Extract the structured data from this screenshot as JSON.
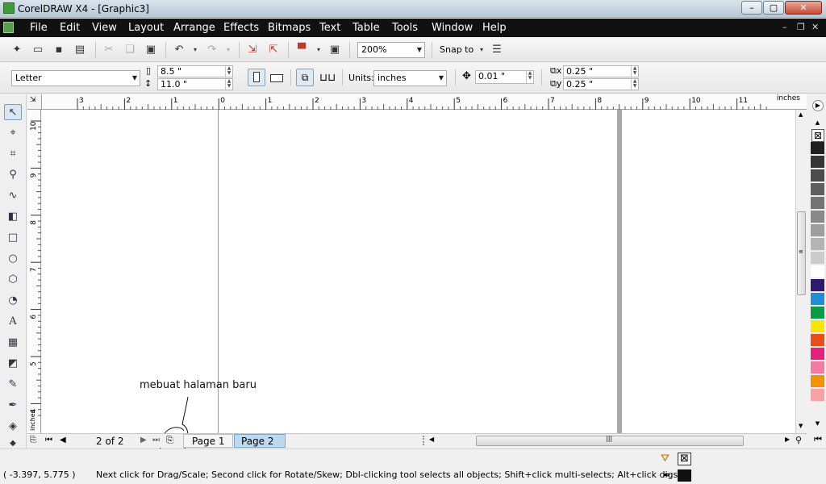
{
  "app": {
    "title": "CorelDRAW X4 - [Graphic3]"
  },
  "menu": [
    "File",
    "Edit",
    "View",
    "Layout",
    "Arrange",
    "Effects",
    "Bitmaps",
    "Text",
    "Table",
    "Tools",
    "Window",
    "Help"
  ],
  "toolbar": {
    "zoom": "200%",
    "snap_to": "Snap to"
  },
  "property_bar": {
    "page_size": "Letter",
    "width": "8.5 \"",
    "height": "11.0 \"",
    "units_label": "Units:",
    "units_value": "inches",
    "nudge": "0.01 \"",
    "dup_x": "0.25 \"",
    "dup_y": "0.25 \""
  },
  "ruler": {
    "units_label": "inches",
    "h_ticks": [
      "3",
      "2",
      "1",
      "0",
      "1",
      "2",
      "3",
      "4",
      "5",
      "6",
      "7",
      "8",
      "9",
      "10",
      "11"
    ],
    "v_ticks": [
      "10",
      "9",
      "8",
      "7",
      "6",
      "5",
      "4"
    ],
    "v_units": "inches"
  },
  "palette": {
    "colors": [
      "#202020",
      "#363636",
      "#4b4b4b",
      "#5f5f5f",
      "#747474",
      "#898989",
      "#9e9e9e",
      "#b4b4b4",
      "#cbcbcb",
      "#ffffff",
      "#2e1a6e",
      "#1d8fd6",
      "#0a9b48",
      "#f5e500",
      "#e94e19",
      "#e6207e",
      "#f27aa3",
      "#f39200",
      "#f7a1a0"
    ]
  },
  "page_nav": {
    "counter": "2 of 2",
    "tabs": [
      "Page 1",
      "Page 2"
    ]
  },
  "annotation": "mebuat halaman baru",
  "status": {
    "coords": "( -3.397, 5.775 )",
    "hint": "Next click for Drag/Scale; Second click for Rotate/Skew; Dbl-clicking tool selects all objects; Shift+click multi-selects; Alt+click digs"
  }
}
